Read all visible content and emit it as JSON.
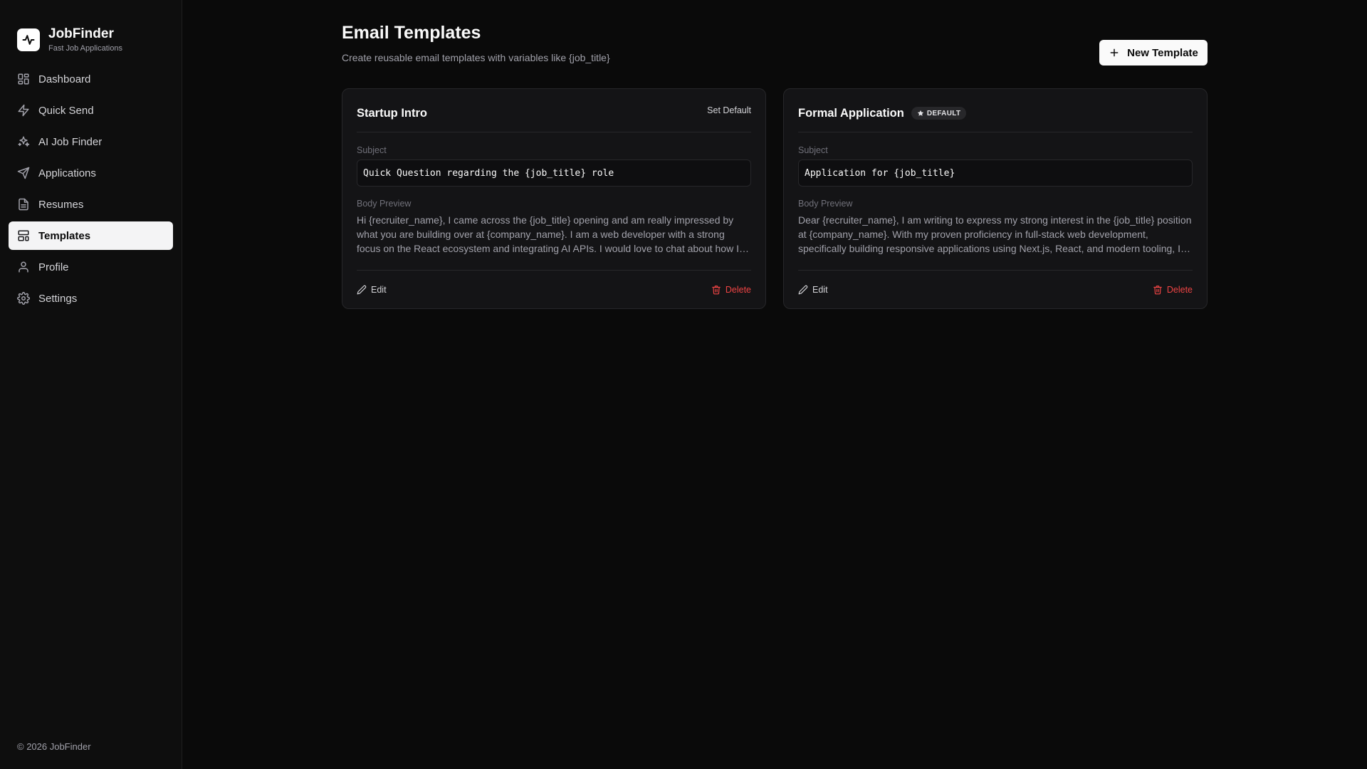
{
  "brand": {
    "name": "JobFinder",
    "tagline": "Fast Job Applications"
  },
  "sidebar": {
    "items": [
      {
        "label": "Dashboard",
        "icon": "dashboard-icon",
        "active": false
      },
      {
        "label": "Quick Send",
        "icon": "lightning-icon",
        "active": false
      },
      {
        "label": "AI Job Finder",
        "icon": "sparkles-icon",
        "active": false
      },
      {
        "label": "Applications",
        "icon": "send-icon",
        "active": false
      },
      {
        "label": "Resumes",
        "icon": "document-icon",
        "active": false
      },
      {
        "label": "Templates",
        "icon": "templates-icon",
        "active": true
      },
      {
        "label": "Profile",
        "icon": "user-icon",
        "active": false
      },
      {
        "label": "Settings",
        "icon": "gear-icon",
        "active": false
      }
    ],
    "footer": "© 2026 JobFinder"
  },
  "page": {
    "title": "Email Templates",
    "subtitle": "Create reusable email templates with variables like {job_title}",
    "new_button": "New Template"
  },
  "templates": [
    {
      "name": "Startup Intro",
      "is_default": false,
      "set_default_label": "Set Default",
      "subject_label": "Subject",
      "subject": "Quick Question regarding the {job_title} role",
      "body_label": "Body Preview",
      "body": "Hi {recruiter_name}, I came across the {job_title} opening and am really impressed by what you are building over at {company_name}. I am a web developer with a strong focus on the React ecosystem and integrating AI APIs. I would love to chat about how I could contribute to your team.",
      "edit_label": "Edit",
      "delete_label": "Delete"
    },
    {
      "name": "Formal Application",
      "is_default": true,
      "default_badge": "DEFAULT",
      "subject_label": "Subject",
      "subject": "Application for {job_title}",
      "body_label": "Body Preview",
      "body": "Dear {recruiter_name}, I am writing to express my strong interest in the {job_title} position at {company_name}. With my proven proficiency in full-stack web development, specifically building responsive applications using Next.js, React, and modern tooling, I am confident I can add value.",
      "edit_label": "Edit",
      "delete_label": "Delete"
    }
  ],
  "colors": {
    "accent": "#fafafa",
    "danger": "#ef4444",
    "background": "#0a0a0a",
    "card": "#141416"
  }
}
